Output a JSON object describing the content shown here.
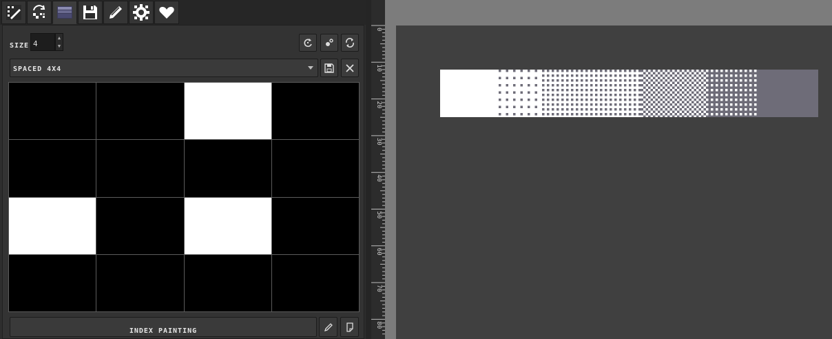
{
  "toolbar": {
    "tools": [
      {
        "icon": "pixel-pencil-icon"
      },
      {
        "icon": "swap-colors-icon"
      },
      {
        "icon": "dither-palette-icon"
      },
      {
        "icon": "save-disk-icon"
      },
      {
        "icon": "pencil-icon"
      },
      {
        "icon": "gear-icon"
      },
      {
        "icon": "heart-icon"
      }
    ]
  },
  "panel": {
    "size_label": "SIZE",
    "size_value": "4",
    "buttons": [
      {
        "icon": "rotate-icon"
      },
      {
        "icon": "dots-icon"
      },
      {
        "icon": "refresh-icon"
      }
    ],
    "pattern_select": "SPACED 4X4",
    "pattern_grid": [
      [
        0,
        0,
        1,
        0
      ],
      [
        0,
        0,
        0,
        0
      ],
      [
        1,
        0,
        1,
        0
      ],
      [
        0,
        0,
        0,
        0
      ]
    ],
    "main_button": "INDEX PAINTING"
  },
  "ruler": {
    "labels": [
      "0",
      "10",
      "20",
      "30",
      "40",
      "50",
      "60",
      "70",
      "80"
    ]
  },
  "colors": {
    "panel_bg": "#333333",
    "workspace_bg": "#404040",
    "strip_tint": "#6e6c78"
  }
}
